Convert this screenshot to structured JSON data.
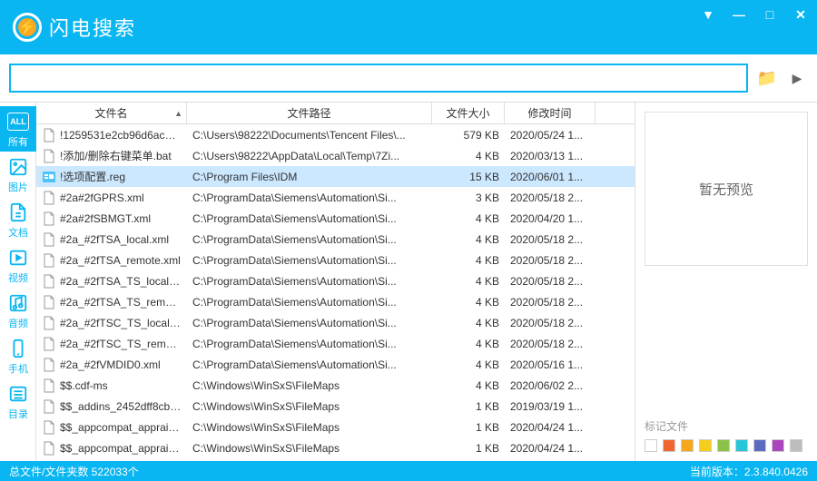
{
  "app": {
    "name": "闪电搜索"
  },
  "window_controls": {
    "dropdown": "▼",
    "minimize": "—",
    "maximize": "□",
    "close": "✕"
  },
  "search": {
    "placeholder": "",
    "folder_icon": "📁",
    "arrow_icon": "▶"
  },
  "sidebar": {
    "items": [
      {
        "label": "所有",
        "icon_text": "ALL"
      },
      {
        "label": "图片",
        "icon": "image"
      },
      {
        "label": "文档",
        "icon": "doc"
      },
      {
        "label": "视频",
        "icon": "video"
      },
      {
        "label": "音频",
        "icon": "audio"
      },
      {
        "label": "手机",
        "icon": "phone"
      },
      {
        "label": "目录",
        "icon": "list"
      }
    ]
  },
  "columns": {
    "name": "文件名",
    "path": "文件路径",
    "size": "文件大小",
    "time": "修改时间",
    "sort": "▲"
  },
  "files": [
    {
      "name": "!1259531e2cb96d6ac5e...",
      "path": "C:\\Users\\98222\\Documents\\Tencent Files\\...",
      "size": "579 KB",
      "time": "2020/05/24 1...",
      "icon": "file"
    },
    {
      "name": "!添加/删除右键菜单.bat",
      "path": "C:\\Users\\98222\\AppData\\Local\\Temp\\7Zi...",
      "size": "4 KB",
      "time": "2020/03/13 1...",
      "icon": "file"
    },
    {
      "name": "!选项配置.reg",
      "path": "C:\\Program Files\\IDM",
      "size": "15 KB",
      "time": "2020/06/01 1...",
      "icon": "reg",
      "selected": true
    },
    {
      "name": "#2a#2fGPRS.xml",
      "path": "C:\\ProgramData\\Siemens\\Automation\\Si...",
      "size": "3 KB",
      "time": "2020/05/18 2...",
      "icon": "file"
    },
    {
      "name": "#2a#2fSBMGT.xml",
      "path": "C:\\ProgramData\\Siemens\\Automation\\Si...",
      "size": "4 KB",
      "time": "2020/04/20 1...",
      "icon": "file"
    },
    {
      "name": "#2a_#2fTSA_local.xml",
      "path": "C:\\ProgramData\\Siemens\\Automation\\Si...",
      "size": "4 KB",
      "time": "2020/05/18 2...",
      "icon": "file"
    },
    {
      "name": "#2a_#2fTSA_remote.xml",
      "path": "C:\\ProgramData\\Siemens\\Automation\\Si...",
      "size": "4 KB",
      "time": "2020/05/18 2...",
      "icon": "file"
    },
    {
      "name": "#2a_#2fTSA_TS_local.xml",
      "path": "C:\\ProgramData\\Siemens\\Automation\\Si...",
      "size": "4 KB",
      "time": "2020/05/18 2...",
      "icon": "file"
    },
    {
      "name": "#2a_#2fTSA_TS_remote...",
      "path": "C:\\ProgramData\\Siemens\\Automation\\Si...",
      "size": "4 KB",
      "time": "2020/05/18 2...",
      "icon": "file"
    },
    {
      "name": "#2a_#2fTSC_TS_local.xml",
      "path": "C:\\ProgramData\\Siemens\\Automation\\Si...",
      "size": "4 KB",
      "time": "2020/05/18 2...",
      "icon": "file"
    },
    {
      "name": "#2a_#2fTSC_TS_remote...",
      "path": "C:\\ProgramData\\Siemens\\Automation\\Si...",
      "size": "4 KB",
      "time": "2020/05/18 2...",
      "icon": "file"
    },
    {
      "name": "#2a_#2fVMDID0.xml",
      "path": "C:\\ProgramData\\Siemens\\Automation\\Si...",
      "size": "4 KB",
      "time": "2020/05/16 1...",
      "icon": "file"
    },
    {
      "name": "$$.cdf-ms",
      "path": "C:\\Windows\\WinSxS\\FileMaps",
      "size": "4 KB",
      "time": "2020/06/02 2...",
      "icon": "file"
    },
    {
      "name": "$$_addins_2452dff8cb6...",
      "path": "C:\\Windows\\WinSxS\\FileMaps",
      "size": "1 KB",
      "time": "2019/03/19 1...",
      "icon": "file"
    },
    {
      "name": "$$_appcompat_apprais...",
      "path": "C:\\Windows\\WinSxS\\FileMaps",
      "size": "1 KB",
      "time": "2020/04/24 1...",
      "icon": "file"
    },
    {
      "name": "$$_appcompat_apprais...",
      "path": "C:\\Windows\\WinSxS\\FileMaps",
      "size": "1 KB",
      "time": "2020/04/24 1...",
      "icon": "file"
    }
  ],
  "preview": {
    "empty_text": "暂无预览",
    "tags_label": "标记文件"
  },
  "tag_colors": [
    "#ffffff",
    "#f26430",
    "#f7a71b",
    "#f7cd1b",
    "#8bc34a",
    "#26c6da",
    "#5c6bc0",
    "#ab47bc",
    "#bdbdbd"
  ],
  "status": {
    "left": "总文件/文件夹数 522033个",
    "right": " 当前版本：2.3.840.0426"
  }
}
